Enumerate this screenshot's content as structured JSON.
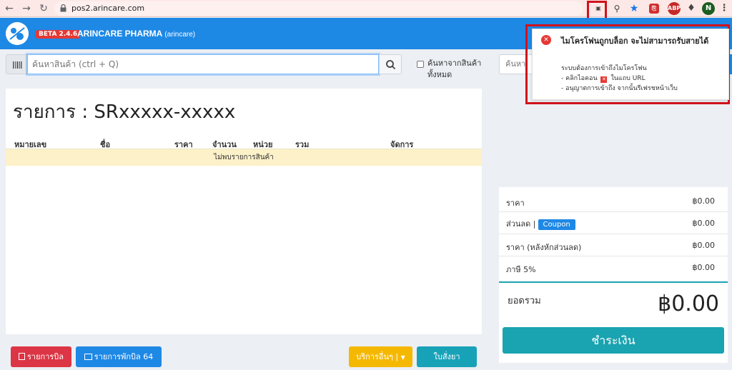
{
  "browser": {
    "url": "pos2.arincare.com",
    "profile_initial": "N",
    "ext_abp": "ABP"
  },
  "app": {
    "version_badge": "BETA 2.4.6",
    "title": "ARINCARE PHARMA",
    "subtitle": "(arincare)",
    "brand_color": "#1e88e5"
  },
  "search": {
    "placeholder": "ค้นหาสินค้า (ctrl + Q)",
    "search_all_label": "ค้นหาจากสินค้าทั้งหมด",
    "second_placeholder": "ค้นหา"
  },
  "order": {
    "title": "รายการ : SRxxxxx-xxxxx",
    "columns": [
      "หมายเลข",
      "ชื่อ",
      "ราคา",
      "จำนวน",
      "หน่วย",
      "รวม",
      "จัดการ"
    ],
    "empty_message": "ไม่พบรายการสินค้า"
  },
  "summary": {
    "price_label": "ราคา",
    "price_value": "฿0.00",
    "discount_label": "ส่วนลด |",
    "coupon_label": "Coupon",
    "discount_value": "฿0.00",
    "net_label": "ราคา (หลังหักส่วนลด)",
    "net_value": "฿0.00",
    "vat_label": "ภาษี 5%",
    "vat_value": "฿0.00",
    "total_label": "ยอดรวม",
    "total_value": "฿0.00",
    "pay_label": "ชำระเงิน"
  },
  "actions": {
    "bill_list": "รายการบิล",
    "hold_list": "รายการพักบิล 64",
    "other_services": "บริการอื่นๆ |",
    "prescription": "ใบสั่งยา"
  },
  "notification": {
    "title": "ไมโครโฟนถูกบล็อก จะไม่สามารถรับสายได้",
    "line1": "ระบบต้องการเข้าถึงไมโครโฟน",
    "line2a": "- คลิกไอคอน",
    "line2b": "ในแถบ URL",
    "line3": "- อนุญาตการเข้าถึง จากนั้นรีเฟรชหน้าเว็บ"
  }
}
